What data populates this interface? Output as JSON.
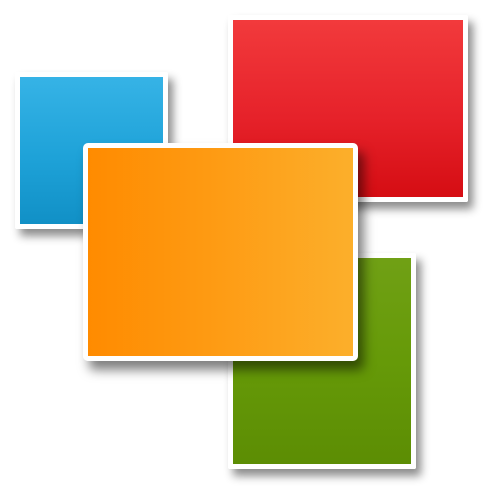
{
  "image": {
    "kind": "icon",
    "tiles": [
      {
        "name": "blue-tile",
        "color": "#1ea2d8"
      },
      {
        "name": "red-tile",
        "color": "#e6222a"
      },
      {
        "name": "green-tile",
        "color": "#669a08"
      },
      {
        "name": "orange-tile",
        "color": "#fe9a12"
      }
    ],
    "border_color": "#ffffff",
    "background": "#ffffff"
  }
}
